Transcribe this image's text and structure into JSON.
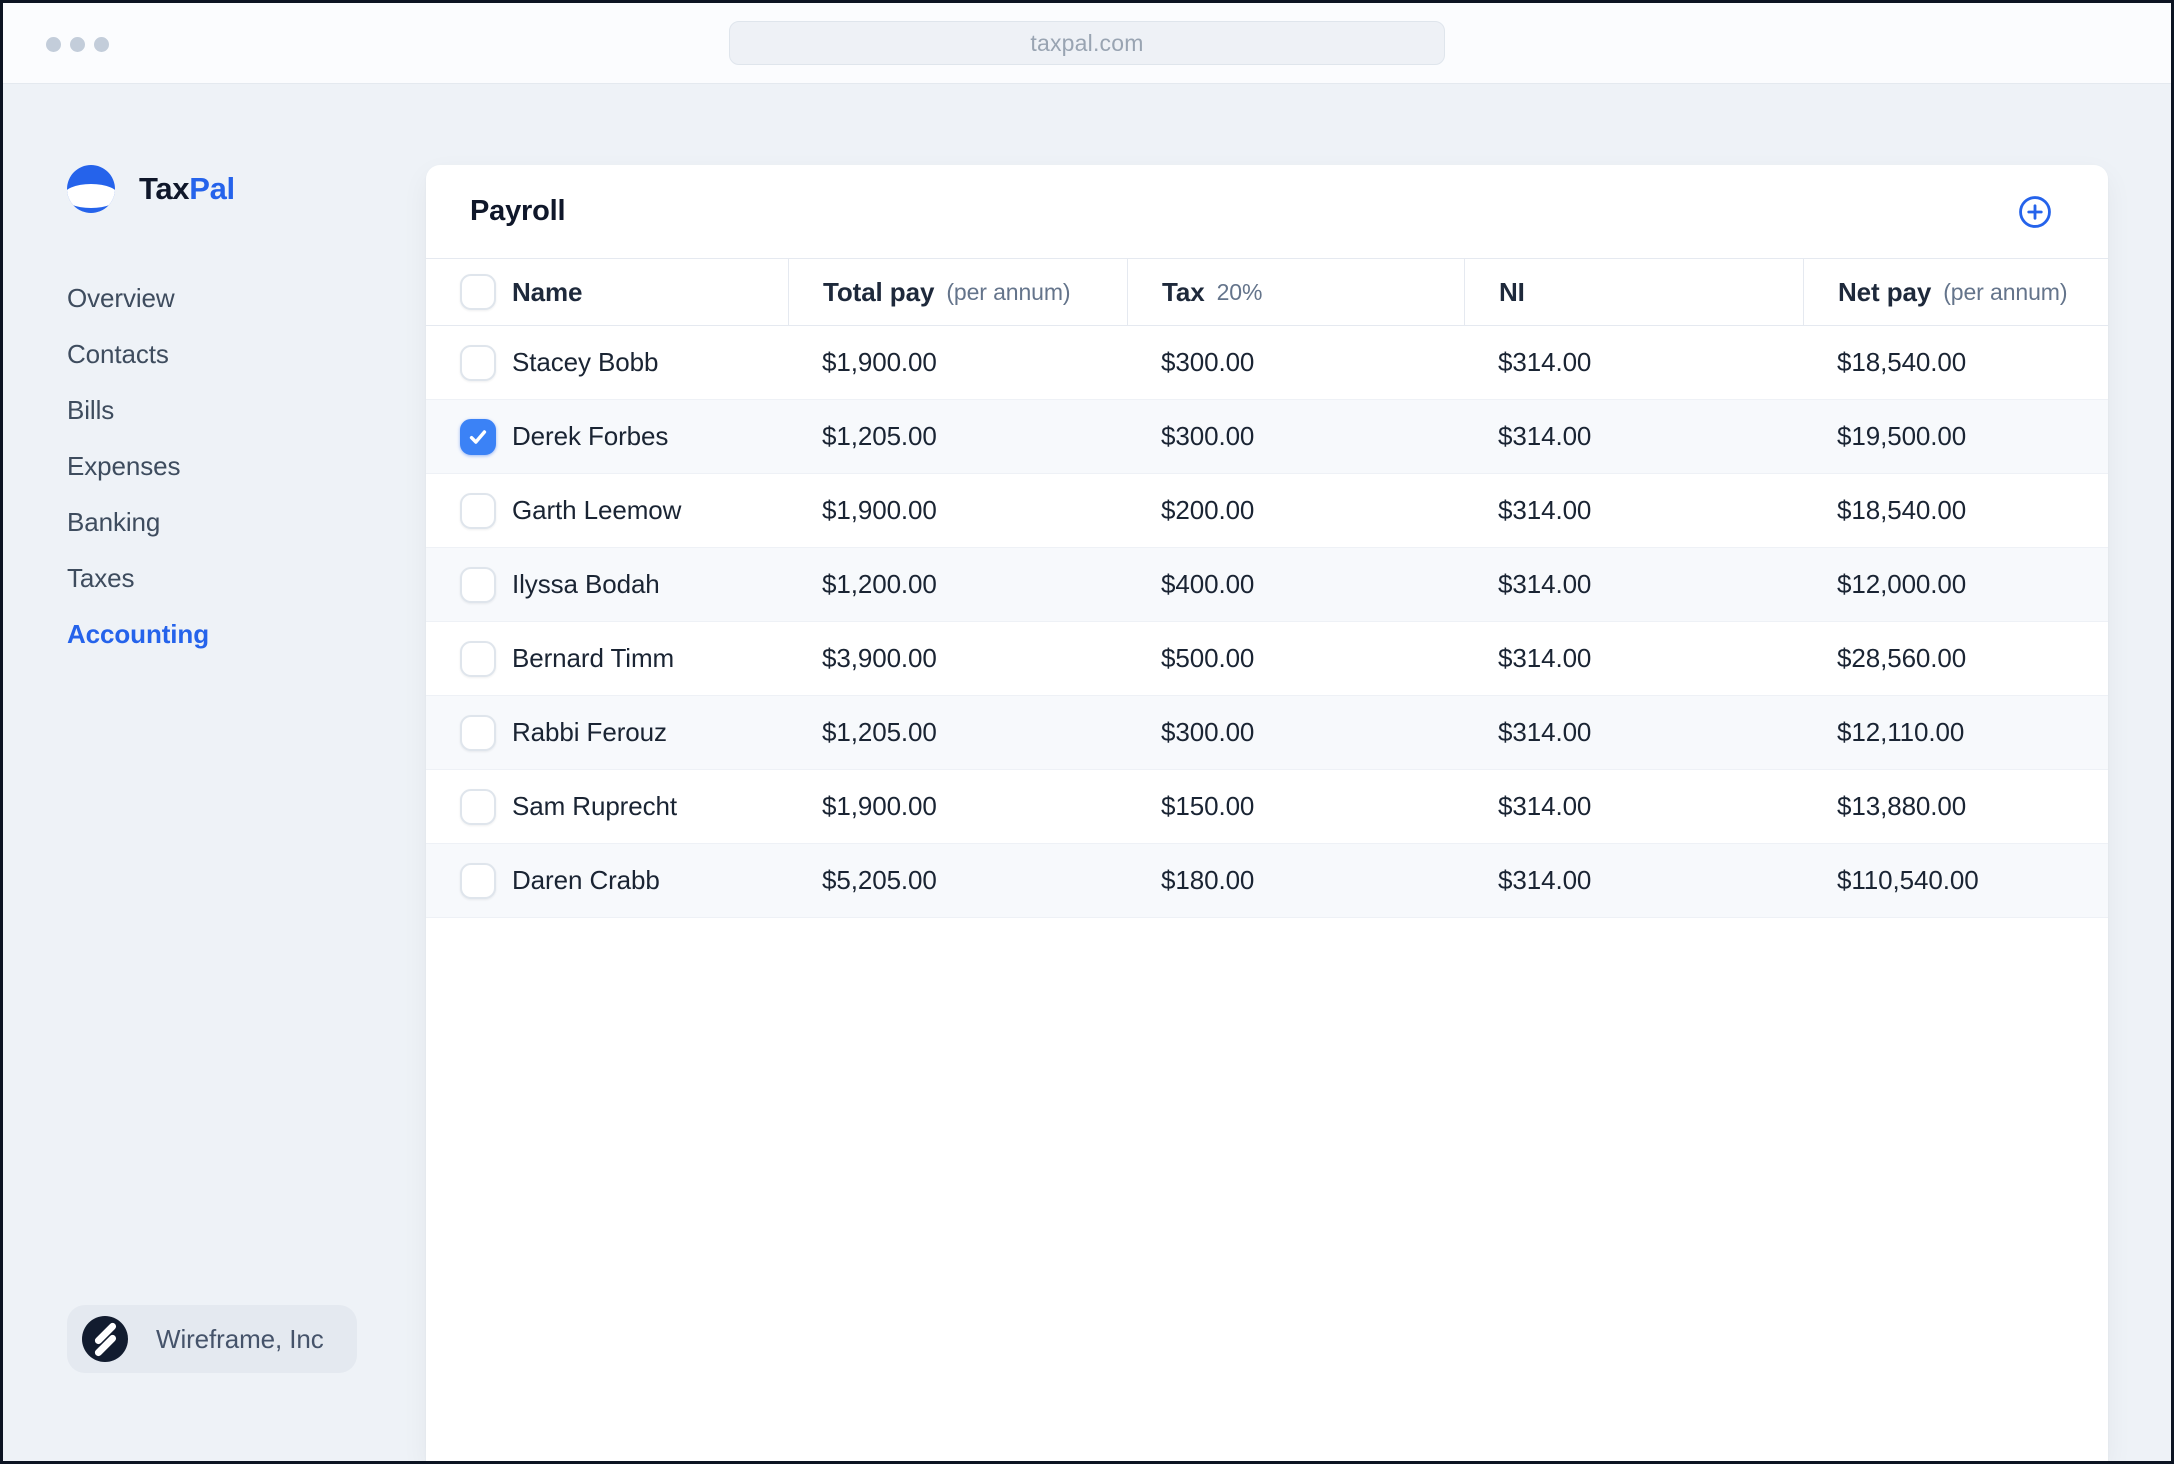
{
  "browser": {
    "url": "taxpal.com"
  },
  "sidebar": {
    "brand": {
      "name_part1": "Tax",
      "name_part2": "Pal"
    },
    "items": [
      {
        "label": "Overview",
        "active": false
      },
      {
        "label": "Contacts",
        "active": false
      },
      {
        "label": "Bills",
        "active": false
      },
      {
        "label": "Expenses",
        "active": false
      },
      {
        "label": "Banking",
        "active": false
      },
      {
        "label": "Taxes",
        "active": false
      },
      {
        "label": "Accounting",
        "active": true
      }
    ],
    "footer": {
      "company": "Wireframe, Inc"
    }
  },
  "main": {
    "title": "Payroll",
    "add_button": "add-row",
    "table": {
      "columns": [
        {
          "label": "Name",
          "hint": ""
        },
        {
          "label": "Total pay",
          "hint": "(per annum)"
        },
        {
          "label": "Tax",
          "hint": "20%"
        },
        {
          "label": "NI",
          "hint": ""
        },
        {
          "label": "Net pay",
          "hint": "(per annum)"
        }
      ],
      "rows": [
        {
          "name": "Stacey Bobb",
          "total_pay": "$1,900.00",
          "tax": "$300.00",
          "ni": "$314.00",
          "net_pay": "$18,540.00",
          "checked": false
        },
        {
          "name": "Derek Forbes",
          "total_pay": "$1,205.00",
          "tax": "$300.00",
          "ni": "$314.00",
          "net_pay": "$19,500.00",
          "checked": true
        },
        {
          "name": "Garth Leemow",
          "total_pay": "$1,900.00",
          "tax": "$200.00",
          "ni": "$314.00",
          "net_pay": "$18,540.00",
          "checked": false
        },
        {
          "name": "Ilyssa Bodah",
          "total_pay": "$1,200.00",
          "tax": "$400.00",
          "ni": "$314.00",
          "net_pay": "$12,000.00",
          "checked": false
        },
        {
          "name": "Bernard Timm",
          "total_pay": "$3,900.00",
          "tax": "$500.00",
          "ni": "$314.00",
          "net_pay": "$28,560.00",
          "checked": false
        },
        {
          "name": "Rabbi Ferouz",
          "total_pay": "$1,205.00",
          "tax": "$300.00",
          "ni": "$314.00",
          "net_pay": "$12,110.00",
          "checked": false
        },
        {
          "name": "Sam Ruprecht",
          "total_pay": "$1,900.00",
          "tax": "$150.00",
          "ni": "$314.00",
          "net_pay": "$13,880.00",
          "checked": false
        },
        {
          "name": "Daren Crabb",
          "total_pay": "$5,205.00",
          "tax": "$180.00",
          "ni": "$314.00",
          "net_pay": "$110,540.00",
          "checked": false
        }
      ]
    }
  },
  "colors": {
    "accent": "#2563eb",
    "checkbox_checked": "#3b82f6",
    "text_primary": "#0f172a",
    "text_secondary": "#64748b",
    "background": "#eef2f7",
    "card": "#ffffff",
    "row_alt": "#f7f9fc",
    "border": "#e5e9f0"
  }
}
